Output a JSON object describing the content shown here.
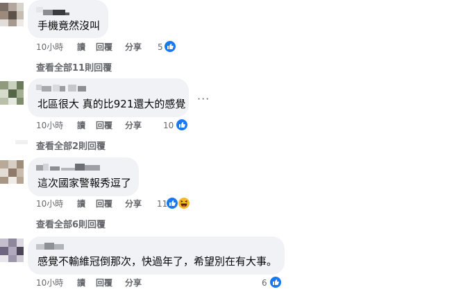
{
  "comments": [
    {
      "text": "手機竟然沒叫",
      "time": "10小時",
      "read_label": "讀",
      "reply_label": "回覆",
      "share_label": "分享",
      "reaction_count": "5",
      "view_replies": "查看全部11則回覆"
    },
    {
      "text": "北區很大 真的比921還大的感覺",
      "time": "10小時",
      "read_label": "讀",
      "reply_label": "回覆",
      "share_label": "分享",
      "reaction_count": "10",
      "view_replies": "查看全部2則回覆",
      "more_label": "···"
    },
    {
      "text": "這次國家警報秀逗了",
      "time": "10小時",
      "read_label": "讀",
      "reply_label": "回覆",
      "share_label": "分享",
      "reaction_count": "11",
      "view_replies": "查看全部6則回覆"
    },
    {
      "text": "感覺不輸維冠倒那次，快過年了，希望別在有大事。",
      "time": "10小時",
      "read_label": "讀",
      "reply_label": "回覆",
      "share_label": "分享",
      "reaction_count": "6"
    }
  ],
  "colors": {
    "bubble": "#f0f2f5",
    "meta_text": "#65676b",
    "like_blue": "#1877f2",
    "haha_yellow": "#f7b928"
  }
}
